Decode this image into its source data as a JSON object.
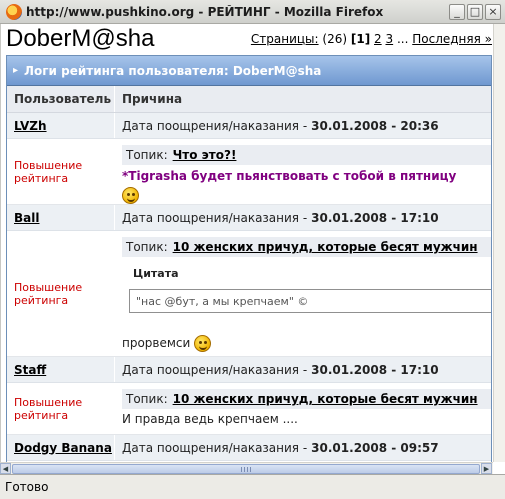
{
  "window": {
    "title": "http://www.pushkino.org - РЕЙТИНГ - Mozilla Firefox",
    "minimize_label": "_",
    "restore_label": "□",
    "close_label": "×"
  },
  "page": {
    "user_title": "DoberM@sha",
    "pagination": {
      "prefix": "Страницы:",
      "total": "(26)",
      "current": "[1]",
      "page2": "2",
      "page3": "3",
      "ellipsis": "...",
      "last": "Последняя »"
    },
    "category_title": "Логи рейтинга пользователя: DoberM@sha",
    "columns": {
      "user": "Пользователь",
      "reason": "Причина"
    },
    "date_label": "Дата поощрения/наказания -",
    "topic_label": "Топик:",
    "entries": [
      {
        "user": "LVZh",
        "date": "30.01.2008 - 20:36",
        "reason": "Повышение рейтинга",
        "topic": "Что это?!",
        "message": "*Tigrasha будет пьянствовать с тобой в пятницу"
      },
      {
        "user": "Ball",
        "date": "30.01.2008 - 17:10",
        "reason": "Повышение рейтинга",
        "topic": "10 женских причуд, которые бесят мужчин",
        "quote_title": "Цитата",
        "quote": "\"нас @бут, а мы крепчаем\" ©",
        "message": "прорвемси"
      },
      {
        "user": "Staff",
        "date": "30.01.2008 - 17:10",
        "reason": "Повышение рейтинга",
        "topic": "10 женских причуд, которые бесят мужчин",
        "message": "И правда ведь крепчаем ...."
      },
      {
        "user": "Dodgy Banana",
        "date": "30.01.2008 - 09:57"
      }
    ]
  },
  "status": {
    "text": "Готово"
  },
  "colors": {
    "reason": "#cc0000",
    "purple_message": "#800080",
    "category_bar": "#6f98d0"
  },
  "icons": [
    "firefox-icon",
    "smiley-grin-icon",
    "smiley-flex-icon",
    "arrow-right-icon"
  ]
}
